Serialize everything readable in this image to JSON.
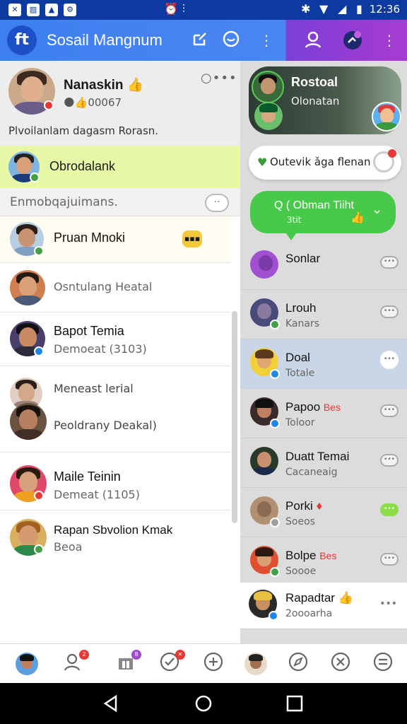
{
  "status_bar": {
    "time": "12:36",
    "left_icons": [
      "gallery-icon",
      "photo-icon",
      "image-icon",
      "alarm-icon"
    ],
    "right_icons": [
      "bluetooth-icon",
      "wifi-icon",
      "signal-icon",
      "battery-icon"
    ]
  },
  "app_bar": {
    "logo_glyph": "ft",
    "title": "Sosail Mangnum",
    "icons": [
      "compose-icon",
      "chat-bubble-icon",
      "more-vert-icon",
      "person-icon",
      "status-icon",
      "more-vert-icon"
    ]
  },
  "profile": {
    "name": "Nanaskin",
    "emoji": "👍",
    "sub": "🌑👍00067",
    "description": "Plvoilanlam dagasm Rorasn.",
    "more": "○•••"
  },
  "highlight": {
    "label": "Obrodalank"
  },
  "section": {
    "label": "Enmobqajuimans.",
    "button": "⋅⋅"
  },
  "contacts": [
    {
      "name": "Pruan Mnoki",
      "sub": "",
      "emoji": "😀"
    },
    {
      "name": "",
      "sub": "Osntulang Heatal"
    },
    {
      "name": "Bapot Temia",
      "sub": "Demoeat (3103)"
    },
    {
      "name": "Meneast lerial",
      "sub": "Peoldrany Deakal)"
    },
    {
      "name": "Maile Teinin",
      "sub": "Demeat (1105)"
    },
    {
      "name": "Rapan Sbvolion Kmak",
      "sub": "Beoa"
    }
  ],
  "right": {
    "story": {
      "title": "Rostoal",
      "sub": "Olonatan"
    },
    "pill": {
      "text": "Outevik ǎga flenan"
    },
    "bubble": {
      "text": "Q ( Obman Tiiht",
      "sub": "3tit"
    },
    "chats": [
      {
        "name": "Sonlar",
        "sub": ""
      },
      {
        "name": "Lrouh",
        "sub": "Kanars"
      },
      {
        "name": "Doal",
        "sub": "Totale"
      },
      {
        "name": "Papoo",
        "sub": "Toloor",
        "tag": "Bes"
      },
      {
        "name": "Duatt Temai",
        "sub": "Cacaneaig"
      },
      {
        "name": "Porki",
        "sub": "Soeos"
      },
      {
        "name": "Bolpe",
        "sub": "Soooe",
        "tag": "Bes"
      },
      {
        "name": "Rapadtar",
        "sub": "2oooarha"
      }
    ]
  },
  "bottom_nav": {
    "badge_counts": [
      "",
      "2",
      "",
      "8",
      "",
      "",
      "",
      "",
      ""
    ]
  },
  "colors": {
    "status_bar": "#0c3aa0",
    "app_bar": "#3d7ff0",
    "app_bar_right": "#a83bd1",
    "highlight": "#e6f7a6",
    "bubble": "#49c94a",
    "badge_red": "#e53935",
    "badge_green": "#43a047",
    "badge_blue": "#1e88e5"
  }
}
